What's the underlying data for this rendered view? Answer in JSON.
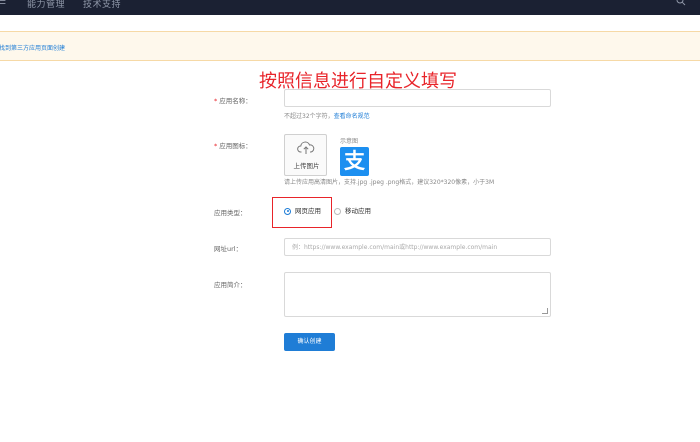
{
  "topbar": {
    "nav_items": [
      "能力管理",
      "技术支持"
    ]
  },
  "notice": {
    "text": "找到第三方应用页面创建"
  },
  "annotation": {
    "text": "按照信息进行自定义填写"
  },
  "form": {
    "app_name": {
      "required_mark": "*",
      "label": "应用名称：",
      "value": "",
      "hint": "不超过32个字符，",
      "hint_link": "查看命名规范"
    },
    "app_icon": {
      "required_mark": "*",
      "label": "应用图标：",
      "upload_label": "上传图片",
      "sample_label": "示意图",
      "sample_glyph": "支",
      "hint": "请上传应用高清图片，支持.jpg .jpeg .png格式，建议320*320像素，小于3M"
    },
    "app_type": {
      "label": "应用类型：",
      "options": [
        {
          "label": "网页应用",
          "selected": true
        },
        {
          "label": "移动应用",
          "selected": false
        }
      ]
    },
    "url": {
      "label": "网址url：",
      "value": "",
      "placeholder": "例：https://www.example.com/main或http://www.example.com/main"
    },
    "intro": {
      "label": "应用简介：",
      "value": ""
    },
    "submit_label": "确认创建"
  },
  "colors": {
    "topbar": "#1b2133",
    "notice_bg": "#fef8ec",
    "accent": "#1f7dd6",
    "annotation": "#e8242a"
  }
}
